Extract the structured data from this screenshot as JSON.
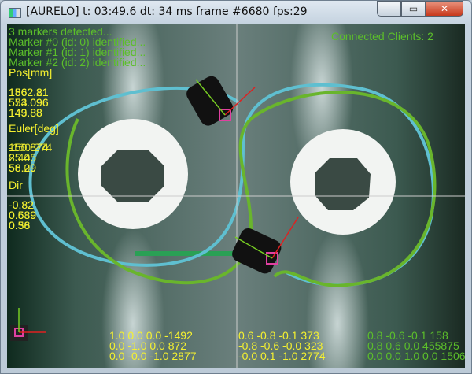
{
  "window": {
    "title": "[AURELO] t: 03:49.6 dt: 34 ms frame #6680 fps:29",
    "minimize": "—",
    "maximize": "▭",
    "close": "✕"
  },
  "status": {
    "detected": "3 markers detected...",
    "markers": [
      "Marker #0 (id: 0) identified...",
      "Marker #1 (id: 1) identified...",
      "Marker #2 (id: 2) identified..."
    ],
    "clients": "Connected Clients: 2"
  },
  "pos": {
    "label": "Pos[mm]",
    "a": [
      "1862.81",
      "553.096",
      "149.88"
    ],
    "b": [
      "1562.21",
      "574.096",
      "143.88"
    ]
  },
  "euler": {
    "label": "Euler[deg]",
    "a": [
      "150.874",
      "25.45",
      "58.29"
    ],
    "b": [
      "-160.274",
      "8.405",
      "56.09"
    ]
  },
  "dir": {
    "label": "Dir",
    "a": [
      "-0.82",
      "0.689",
      "0.56"
    ],
    "b": [
      "-0.82",
      "0.539",
      "0.38"
    ]
  },
  "matrices": {
    "m1": [
      "1.0 0.0 0.0 -1492",
      "0.0 -1.0 0.0 872",
      "0.0 -0.0 -1.0 2877"
    ],
    "m2": [
      "0.6 -0.8 -0.1 373",
      "-0.8 -0.6 -0.0 323",
      "-0.0 0.1 -1.0 2774"
    ],
    "m3": [
      "0.8 -0.6 -0.1 158",
      "0.8 0.6 0.0 455875",
      "0.0 0.0 1.0 0.0 1506"
    ]
  },
  "colors": {
    "green": "#5cbf2a",
    "yellow": "#f4f030",
    "blue_track": "#5fbfd0"
  }
}
